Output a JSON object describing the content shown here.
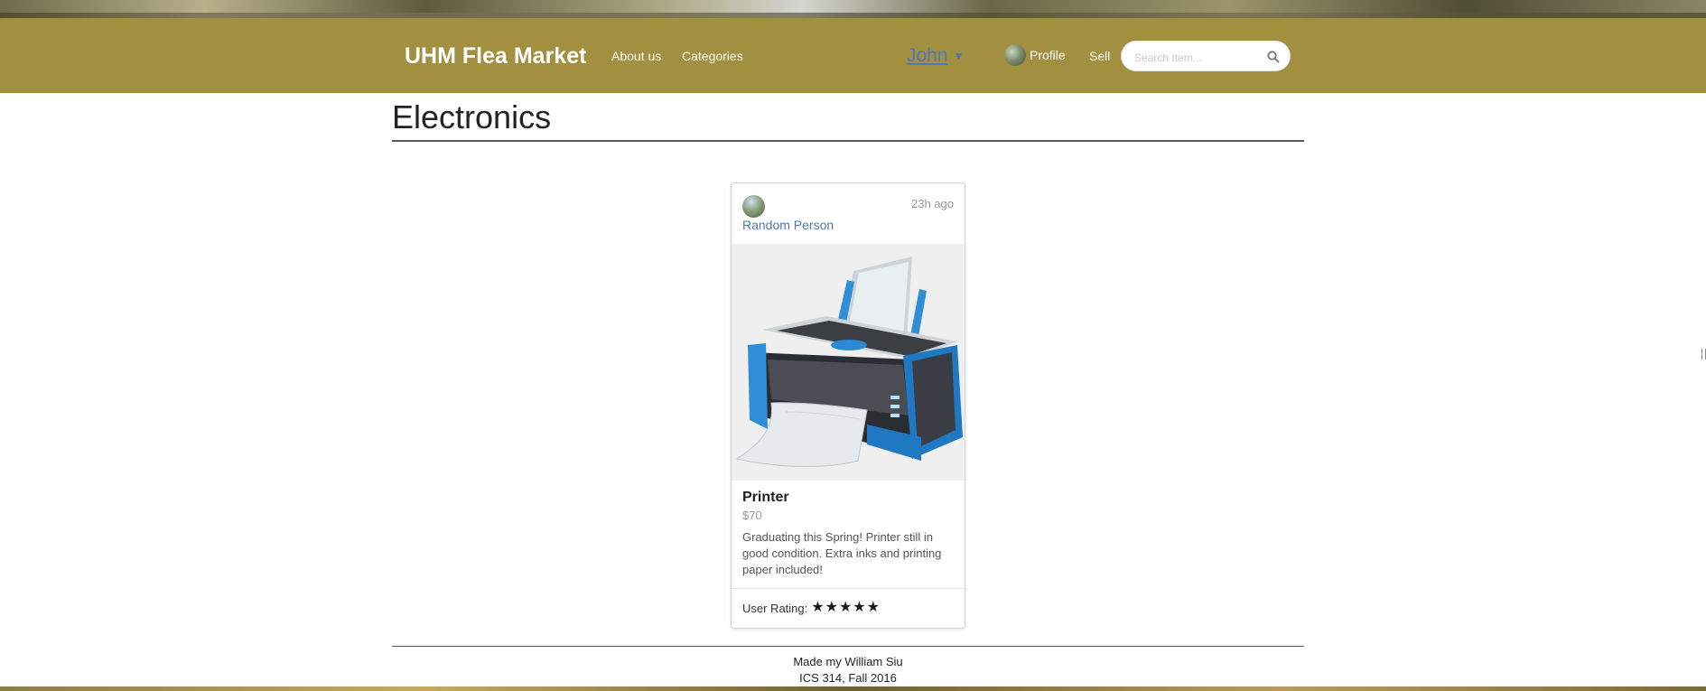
{
  "header": {
    "brand": "UHM Flea Market",
    "nav": {
      "about": "About us",
      "categories": "Categories",
      "user": "John",
      "profile": "Profile",
      "sell": "Sell"
    },
    "search": {
      "placeholder": "Search Item...",
      "value": ""
    },
    "colors": {
      "navbar": "#a29040",
      "link": "#4a78b8"
    }
  },
  "page": {
    "title": "Electronics"
  },
  "listing": {
    "seller": "Random Person",
    "time": "23h ago",
    "image_icon": "printer-image",
    "name": "Printer",
    "price": "$70",
    "description": "Graduating this Spring! Printer still in good condition. Extra inks and printing paper included!",
    "rating_label": "User Rating:",
    "rating_stars": 5,
    "rating_max": 5
  },
  "footer": {
    "line1": "Made my William Siu",
    "line2": "ICS 314, Fall 2016"
  }
}
